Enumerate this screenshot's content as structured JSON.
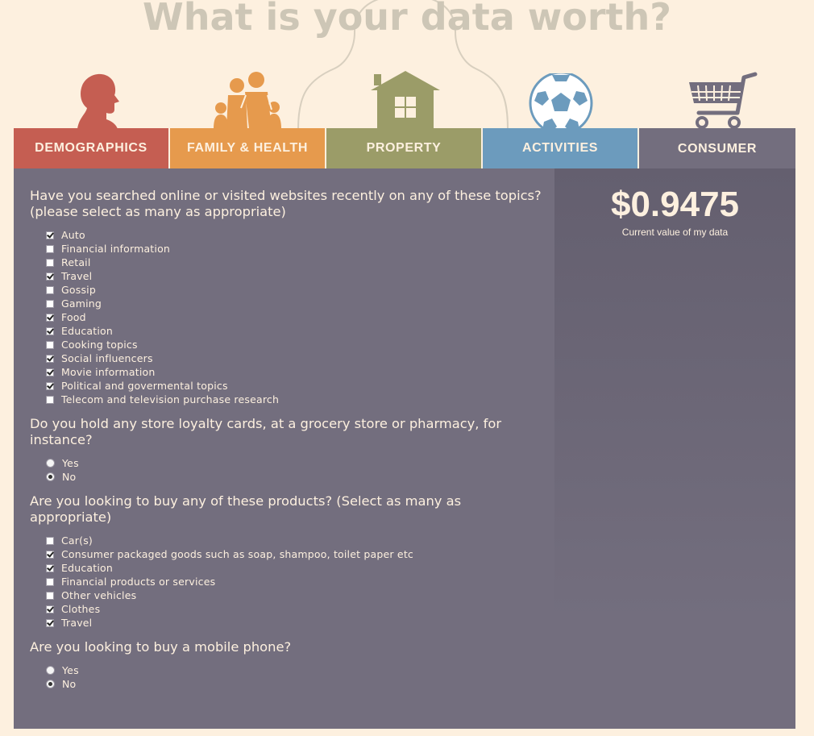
{
  "title": "What is your data worth?",
  "tabs": [
    {
      "label": "DEMOGRAPHICS",
      "color": "#c55e52",
      "icon": "person-head-icon"
    },
    {
      "label": "FAMILY & HEALTH",
      "color": "#e69a4d",
      "icon": "family-icon"
    },
    {
      "label": "PROPERTY",
      "color": "#9b9c68",
      "icon": "house-icon"
    },
    {
      "label": "ACTIVITIES",
      "color": "#6c9bbd",
      "icon": "soccer-ball-icon"
    },
    {
      "label": "CONSUMER",
      "color": "#736e7e",
      "icon": "shopping-cart-icon",
      "active": true
    }
  ],
  "sidebar": {
    "value": "$0.9475",
    "value_label": "Current value of my data"
  },
  "questions": [
    {
      "text": "Have you searched online or visited websites recently on any of these topics? (please select as many as appropriate)",
      "type": "checkbox",
      "options": [
        {
          "label": "Auto",
          "checked": true
        },
        {
          "label": "Financial information",
          "checked": false
        },
        {
          "label": "Retail",
          "checked": false
        },
        {
          "label": "Travel",
          "checked": true
        },
        {
          "label": "Gossip",
          "checked": false
        },
        {
          "label": "Gaming",
          "checked": false
        },
        {
          "label": "Food",
          "checked": true
        },
        {
          "label": "Education",
          "checked": true
        },
        {
          "label": "Cooking topics",
          "checked": false
        },
        {
          "label": "Social influencers",
          "checked": true
        },
        {
          "label": "Movie information",
          "checked": true
        },
        {
          "label": "Political and govermental topics",
          "checked": true
        },
        {
          "label": "Telecom and television purchase research",
          "checked": false
        }
      ]
    },
    {
      "text": "Do you hold any store loyalty cards, at a grocery store or pharmacy, for instance?",
      "type": "radio",
      "options": [
        {
          "label": "Yes",
          "checked": false
        },
        {
          "label": "No",
          "checked": true
        }
      ]
    },
    {
      "text": "Are you looking to buy any of these products? (Select as many as appropriate)",
      "type": "checkbox",
      "options": [
        {
          "label": "Car(s)",
          "checked": false
        },
        {
          "label": "Consumer packaged goods such as soap, shampoo, toilet paper etc",
          "checked": true
        },
        {
          "label": "Education",
          "checked": true
        },
        {
          "label": "Financial products or services",
          "checked": false
        },
        {
          "label": "Other vehicles",
          "checked": false
        },
        {
          "label": "Clothes",
          "checked": true
        },
        {
          "label": "Travel",
          "checked": true
        }
      ]
    },
    {
      "text": "Are you looking to buy a mobile phone?",
      "type": "radio",
      "options": [
        {
          "label": "Yes",
          "checked": false
        },
        {
          "label": "No",
          "checked": true
        }
      ]
    }
  ]
}
